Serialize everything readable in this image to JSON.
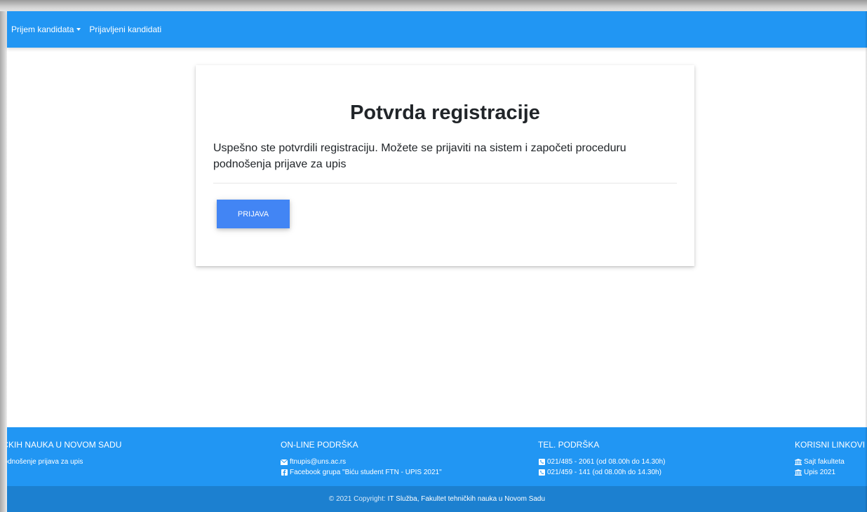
{
  "navbar": {
    "items": [
      {
        "label": "Prijem kandidata"
      },
      {
        "label": "Prijavljeni kandidati"
      }
    ]
  },
  "card": {
    "title": "Potvrda registracije",
    "message": "Uspešno ste potvrdili registraciju. Možete se prijaviti na sistem i započeti proceduru podnošenja prijave za upis",
    "button_label": "PRIJAVA"
  },
  "footer": {
    "col1": {
      "title": "IČKIH NAUKA U NOVOM SADU",
      "line1": "podnošenje prijava za upis"
    },
    "col2": {
      "title": "ON-LINE PODRŠKA",
      "email": "ftnupis@uns.ac.rs",
      "facebook": "Facebook grupa \"Biću student FTN - UPIS 2021\""
    },
    "col3": {
      "title": "TEL. PODRŠKA",
      "phone1": "021/485 - 2061 (od 08.00h do 14.30h)",
      "phone2": "021/459 - 141 (od 08.00h do 14.30h)"
    },
    "col4": {
      "title": "KORISNI LINKOVI",
      "link1": "Sajt fakulteta",
      "link2": "Upis 2021"
    }
  },
  "copyright": {
    "prefix": "© 2021 Copyright:",
    "link": "IT Služba, Fakultet tehničkih nauka u Novom Sadu"
  },
  "colors": {
    "primary": "#2196f3",
    "button": "#4285f4",
    "copyright_bg": "#1c80d0"
  }
}
